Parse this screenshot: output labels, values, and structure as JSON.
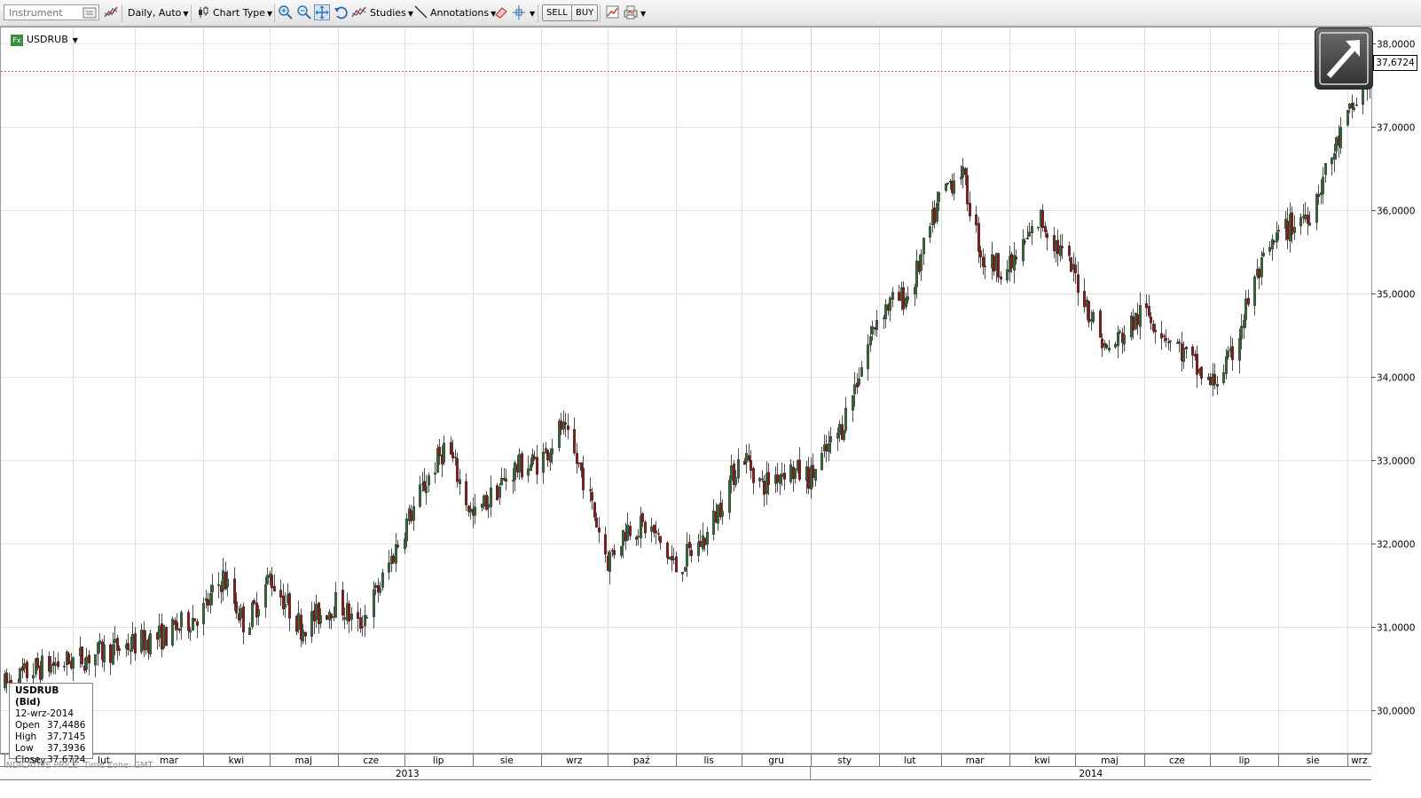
{
  "toolbar": {
    "instrument_placeholder": "Instrument",
    "interval": "Daily,",
    "scale": "Auto",
    "chart_type": "Chart Type",
    "studies": "Studies",
    "annotations": "Annotations",
    "sell": "SELL",
    "buy": "BUY"
  },
  "symbol": {
    "badge": "Fx",
    "name": "USDRUB"
  },
  "info_box": {
    "title": "USDRUB (Bid)",
    "date": "12-wrz-2014",
    "rows": [
      {
        "label": "Open",
        "value": "37,4486"
      },
      {
        "label": "High",
        "value": "37,7145"
      },
      {
        "label": "Low",
        "value": "37,3936"
      },
      {
        "label": "Close",
        "value": "37,6724"
      }
    ]
  },
  "footer": {
    "price_type": "INDICATIVE PRICE",
    "time_zone": "Time Zone: GMT"
  },
  "last_price_tag": "37,6724",
  "colors": {
    "up": "#3a6b3a",
    "down": "#8b1a1a",
    "grid": "#e2e2e2",
    "last_price_line": "#e06666"
  },
  "chart_data": {
    "type": "candlestick",
    "title": "USDRUB",
    "xlabel": "",
    "ylabel": "",
    "ylim": [
      29.5,
      38.1
    ],
    "y_ticks": [
      "30,0000",
      "31,0000",
      "32,0000",
      "33,0000",
      "34,0000",
      "35,0000",
      "36,0000",
      "37,0000",
      "38,0000"
    ],
    "last_close": 37.6724,
    "x_range": [
      "2013-01-01",
      "2014-09-12"
    ],
    "months": [
      "sty",
      "lut",
      "mar",
      "kwi",
      "maj",
      "cze",
      "lip",
      "sie",
      "wrz",
      "paź",
      "lis",
      "gru",
      "sty",
      "lut",
      "mar",
      "kwi",
      "maj",
      "cze",
      "lip",
      "sie",
      "wrz"
    ],
    "years": [
      "2013",
      "2014"
    ],
    "path": [
      {
        "d": "2013-01-01",
        "v": 30.3
      },
      {
        "d": "2013-01-15",
        "v": 30.5
      },
      {
        "d": "2013-02-01",
        "v": 30.6
      },
      {
        "d": "2013-02-15",
        "v": 30.7
      },
      {
        "d": "2013-03-01",
        "v": 30.8
      },
      {
        "d": "2013-03-15",
        "v": 30.9
      },
      {
        "d": "2013-04-01",
        "v": 31.2
      },
      {
        "d": "2013-04-10",
        "v": 31.6
      },
      {
        "d": "2013-04-20",
        "v": 31.0
      },
      {
        "d": "2013-05-01",
        "v": 31.6
      },
      {
        "d": "2013-05-15",
        "v": 31.0
      },
      {
        "d": "2013-06-01",
        "v": 31.3
      },
      {
        "d": "2013-06-10",
        "v": 31.0
      },
      {
        "d": "2013-06-20",
        "v": 31.5
      },
      {
        "d": "2013-07-01",
        "v": 32.2
      },
      {
        "d": "2013-07-10",
        "v": 32.7
      },
      {
        "d": "2013-07-20",
        "v": 33.2
      },
      {
        "d": "2013-08-01",
        "v": 32.3
      },
      {
        "d": "2013-08-10",
        "v": 32.6
      },
      {
        "d": "2013-08-20",
        "v": 32.9
      },
      {
        "d": "2013-09-01",
        "v": 33.0
      },
      {
        "d": "2013-09-10",
        "v": 33.4
      },
      {
        "d": "2013-09-20",
        "v": 32.8
      },
      {
        "d": "2013-10-01",
        "v": 31.8
      },
      {
        "d": "2013-10-10",
        "v": 32.2
      },
      {
        "d": "2013-10-20",
        "v": 32.2
      },
      {
        "d": "2013-11-01",
        "v": 31.7
      },
      {
        "d": "2013-11-15",
        "v": 32.1
      },
      {
        "d": "2013-12-01",
        "v": 33.1
      },
      {
        "d": "2013-12-10",
        "v": 32.7
      },
      {
        "d": "2013-12-20",
        "v": 32.9
      },
      {
        "d": "2014-01-01",
        "v": 32.8
      },
      {
        "d": "2014-01-15",
        "v": 33.4
      },
      {
        "d": "2014-02-01",
        "v": 34.8
      },
      {
        "d": "2014-02-15",
        "v": 35.0
      },
      {
        "d": "2014-03-01",
        "v": 36.2
      },
      {
        "d": "2014-03-10",
        "v": 36.5
      },
      {
        "d": "2014-03-20",
        "v": 35.4
      },
      {
        "d": "2014-04-01",
        "v": 35.3
      },
      {
        "d": "2014-04-15",
        "v": 35.9
      },
      {
        "d": "2014-05-01",
        "v": 35.2
      },
      {
        "d": "2014-05-15",
        "v": 34.3
      },
      {
        "d": "2014-06-01",
        "v": 34.8
      },
      {
        "d": "2014-06-15",
        "v": 34.4
      },
      {
        "d": "2014-07-01",
        "v": 33.9
      },
      {
        "d": "2014-07-10",
        "v": 34.2
      },
      {
        "d": "2014-07-20",
        "v": 35.1
      },
      {
        "d": "2014-08-01",
        "v": 35.7
      },
      {
        "d": "2014-08-15",
        "v": 36.0
      },
      {
        "d": "2014-09-01",
        "v": 37.1
      },
      {
        "d": "2014-09-12",
        "v": 37.67
      }
    ]
  }
}
